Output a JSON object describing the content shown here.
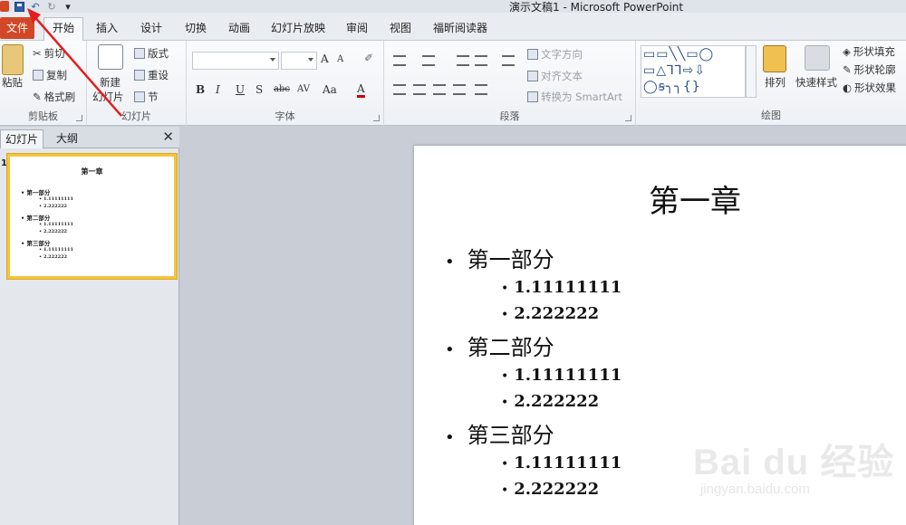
{
  "window": {
    "title": "演示文稿1 - Microsoft PowerPoint",
    "qat": {
      "undo": "↶",
      "redo": "↻",
      "customize": "▾"
    }
  },
  "tabs": {
    "file": "文件",
    "home": "开始",
    "insert": "插入",
    "design": "设计",
    "transitions": "切换",
    "animations": "动画",
    "slideshow": "幻灯片放映",
    "review": "审阅",
    "view": "视图",
    "foxit": "福昕阅读器"
  },
  "ribbon": {
    "clipboard": {
      "label": "剪贴板",
      "paste": "粘贴",
      "cut": "剪切",
      "copy": "复制",
      "format_painter": "格式刷"
    },
    "slides": {
      "label": "幻灯片",
      "new_slide": "新建",
      "new_slide_2": "幻灯片",
      "layout": "版式",
      "reset": "重设",
      "section": "节"
    },
    "font": {
      "label": "字体",
      "bold": "B",
      "italic": "I",
      "underline": "U",
      "shadow": "S",
      "strike": "abc",
      "spacing": "AV",
      "case": "Aa",
      "color": "A",
      "grow": "A",
      "shrink": "A"
    },
    "paragraph": {
      "label": "段落",
      "text_direction": "文字方向",
      "align_text": "对齐文本",
      "smartart": "转换为 SmartArt"
    },
    "drawing": {
      "label": "绘图",
      "shapes_row1": "▭▭╲╲▭◯",
      "shapes_row2": "▭△⅂⅂⇨⇩",
      "shapes_row3": "◯ꞩ╮╮{}",
      "arrange": "排列",
      "quick_styles": "快速样式",
      "fill": "形状填充",
      "outline": "形状轮廓",
      "effects": "形状效果"
    }
  },
  "left_pane": {
    "tab_slides": "幻灯片",
    "tab_outline": "大纲",
    "close": "✕",
    "slide_number": "1"
  },
  "slide": {
    "title": "第一章",
    "sections": [
      {
        "heading": "第一部分",
        "items": [
          "1.11111111",
          "2.222222"
        ]
      },
      {
        "heading": "第二部分",
        "items": [
          "1.11111111",
          "2.222222"
        ]
      },
      {
        "heading": "第三部分",
        "items": [
          "1.11111111",
          "2.222222"
        ]
      }
    ]
  },
  "watermark": {
    "text": "Bai du 经验",
    "url": "jingyan.baidu.com"
  },
  "colors": {
    "file_tab": "#d24726",
    "annotation_arrow": "#e02020",
    "thumb_border": "#f5c53b"
  }
}
